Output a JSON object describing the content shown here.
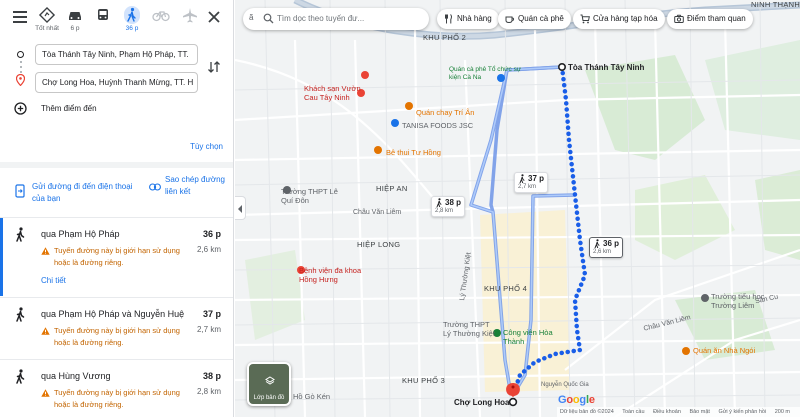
{
  "modes": [
    {
      "label": "Tốt nhất",
      "icon": "best-route-icon"
    },
    {
      "label": "6 p",
      "icon": "car-icon"
    },
    {
      "label": "",
      "icon": "transit-icon"
    },
    {
      "label": "36 p",
      "icon": "walk-icon"
    },
    {
      "label": "",
      "icon": "bicycle-icon"
    },
    {
      "label": "",
      "icon": "flight-icon"
    }
  ],
  "inputs": {
    "origin": "Tòa Thánh Tây Ninh, Phạm Hộ Pháp, TT.",
    "destination": "Chợ Long Hoa, Huỳnh Thanh Mừng, TT. H"
  },
  "add_destination": "Thêm điểm đến",
  "options": "Tùy chọn",
  "share": {
    "send_phone": "Gửi đường đi đến điện thoại của bạn",
    "copy_link": "Sao chép đường liên kết"
  },
  "routes": [
    {
      "title": "qua Phạm Hộ Pháp",
      "duration": "36 p",
      "distance": "2,6 km",
      "warning": "Tuyến đường này bị giới hạn sử dụng hoặc là đường riêng.",
      "detail": "Chi tiết"
    },
    {
      "title": "qua Phạm Hộ Pháp và Nguyễn Huệ",
      "duration": "37 p",
      "distance": "2,7 km",
      "warning": "Tuyến đường này bị giới hạn sử dụng hoặc là đường riêng."
    },
    {
      "title": "qua Hùng Vương",
      "duration": "38 p",
      "distance": "2,8 km",
      "warning": "Tuyến đường này bị giới hạn sử dụng hoặc là đường riêng."
    }
  ],
  "map": {
    "search_lang": "ã",
    "search_placeholder": "Tìm dọc theo tuyến đư...",
    "chips": [
      "Nhà hàng",
      "Quán cà phê",
      "Cửa hàng tạp hóa",
      "Điểm tham quan"
    ],
    "start_label": "Tòa Thánh Tây Ninh",
    "end_label": "Chợ Long Hoa",
    "duration_boxes": [
      {
        "time": "37 p",
        "dist": "2,7 km"
      },
      {
        "time": "38 p",
        "dist": "2,8 km"
      },
      {
        "time": "36 p",
        "dist": "2,6 km"
      }
    ],
    "areas": [
      "KHU PHỐ 2",
      "HIỆP AN",
      "HIỆP LONG",
      "KHU PHỐ 4",
      "KHU PHỐ 3",
      "NINH THẠNH"
    ],
    "pois": {
      "khach_san": "Khách sạn Vườn Cau Tây Ninh",
      "cafe": "Quán cà phê Tổ chức sự kiện Cà Na",
      "quan_chay": "Quán chay Trí Ân",
      "tanisa": "TANISA FOODS JSC",
      "be_thui": "Bê thui Tư Hồng",
      "thpt_lqd": "Trường THPT Lê Quí Đôn",
      "benh_vien": "Bệnh viện đa khoa Hồng Hưng",
      "thpt_ltk": "Trường THPT Lý Thường Kiệt",
      "cong_vien": "Công viên Hòa Thành",
      "tieu_hoc": "Trường tiểu học Trường Liêm",
      "quan_an": "Quán ăn Nhà Ngói",
      "ho_go_ken": "Hồ Gò Kén"
    },
    "roads": [
      "Châu Văn Liêm",
      "Lý Thường Kiệt",
      "Sân Cu",
      "Nguyễn Quốc Gia",
      "Châu Văn Liêm"
    ],
    "layers_label": "Lớp bản đồ",
    "google": "Google",
    "attribution": [
      "Dữ liệu bản đồ ©2024",
      "Toàn cầu",
      "Điều khoản",
      "Bảo mật",
      "Gửi ý kiến phản hồi",
      "200 m"
    ]
  },
  "colors": {
    "accent": "#1a73e8",
    "route_selected": "#1a5ee8",
    "route_alt": "#8ab4f8",
    "warning": "#e37400",
    "destination": "#ea4335"
  }
}
